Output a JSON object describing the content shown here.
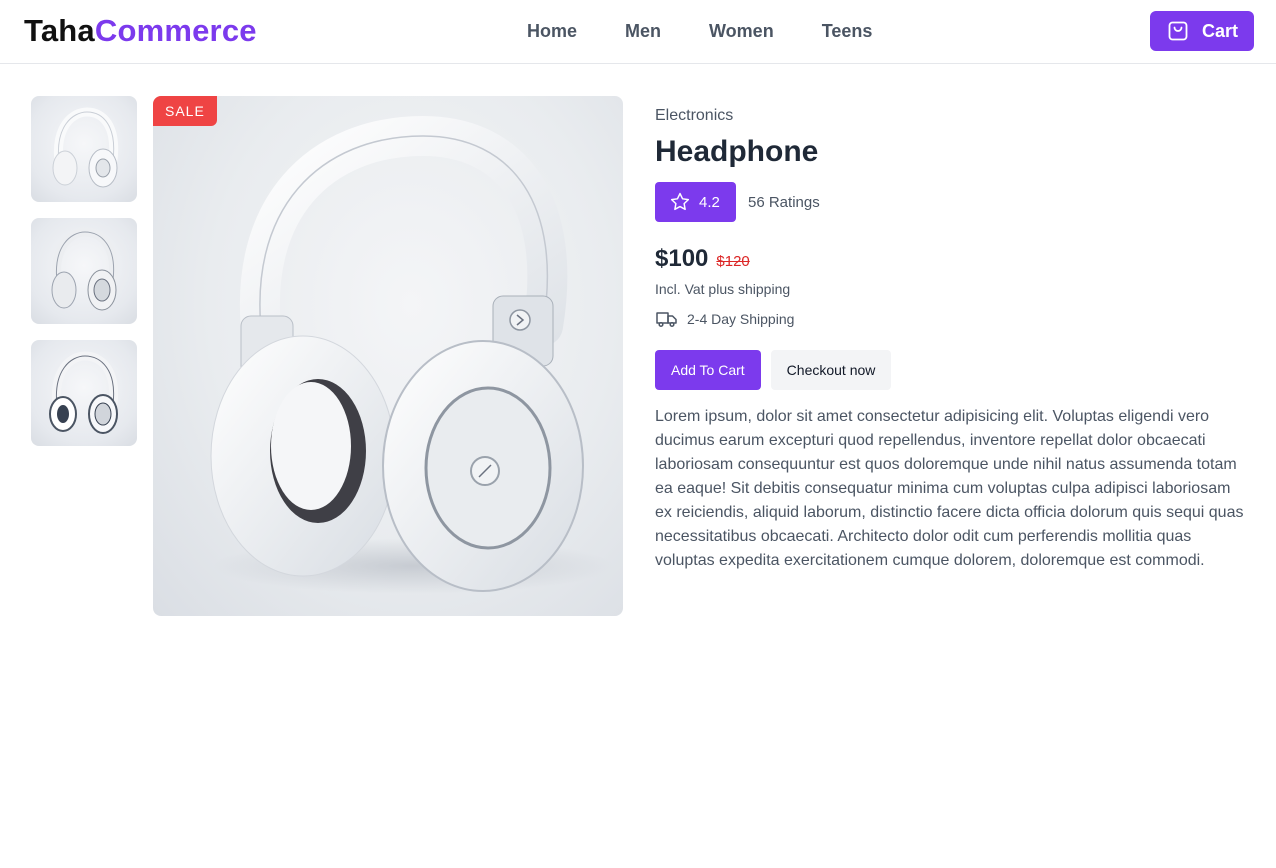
{
  "brand": {
    "part1": "Taha",
    "part2": "Commerce"
  },
  "nav": {
    "items": [
      {
        "label": "Home"
      },
      {
        "label": "Men"
      },
      {
        "label": "Women"
      },
      {
        "label": "Teens"
      }
    ]
  },
  "cart": {
    "label": "Cart",
    "icon": "shopping-bag-icon"
  },
  "gallery": {
    "badge": "SALE",
    "thumbnails": [
      "headphone-thumbnail-1",
      "headphone-thumbnail-2",
      "headphone-thumbnail-3"
    ]
  },
  "product": {
    "category": "Electronics",
    "name": "Headphone",
    "rating": "4.2",
    "rating_count": "56 Ratings",
    "price": "$100",
    "old_price": "$120",
    "vat_note": "Incl. Vat plus shipping",
    "shipping": "2-4 Day Shipping",
    "add_to_cart": "Add To Cart",
    "checkout": "Checkout now",
    "description": "Lorem ipsum, dolor sit amet consectetur adipisicing elit. Voluptas eligendi vero ducimus earum excepturi quod repellendus, inventore repellat dolor obcaecati laboriosam consequuntur est quos doloremque unde nihil natus assumenda totam ea eaque! Sit debitis consequatur minima cum voluptas culpa adipisci laboriosam ex reiciendis, aliquid laborum, distinctio facere dicta officia dolorum quis sequi quas necessitatibus obcaecati. Architecto dolor odit cum perferendis mollitia quas voluptas expedita exercitationem cumque dolorem, doloremque est commodi."
  },
  "colors": {
    "accent": "#7c3aed",
    "sale": "#ef4444",
    "old_price": "#dc2626"
  }
}
